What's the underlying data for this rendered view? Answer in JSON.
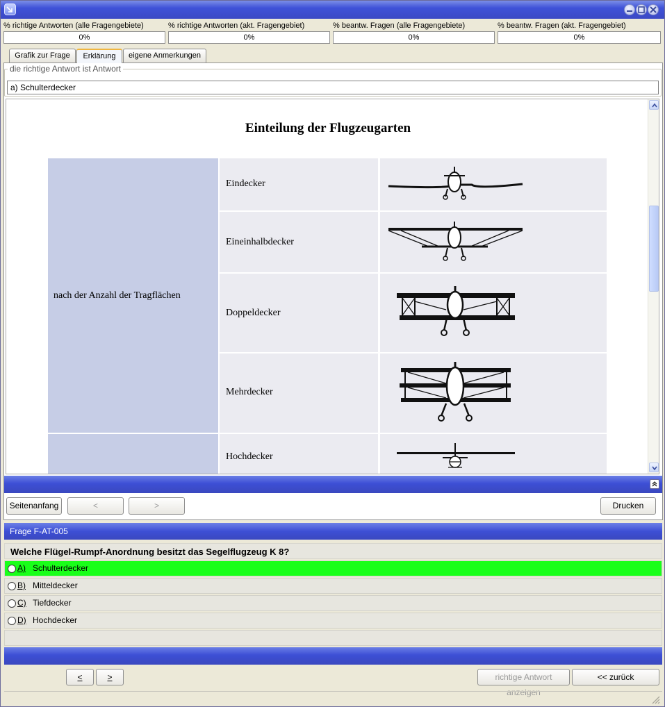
{
  "window": {
    "title": ""
  },
  "stats": [
    {
      "label": "% richtige Antworten (alle Fragengebiete)",
      "value": "0%"
    },
    {
      "label": "% richtige Antworten (akt. Fragengebiet)",
      "value": "0%"
    },
    {
      "label": "% beantw. Fragen (alle Fragengebiete)",
      "value": "0%"
    },
    {
      "label": "% beantw. Fragen (akt.  Fragengebiet)",
      "value": "0%"
    }
  ],
  "tabs": [
    {
      "label": "Grafik zur Frage",
      "active": false
    },
    {
      "label": "Erklärung",
      "active": true
    },
    {
      "label": "eigene Anmerkungen",
      "active": false
    }
  ],
  "answer_group": {
    "legend": "die richtige Antwort ist Antwort",
    "value": "a) Schulterdecker"
  },
  "document": {
    "title": "Einteilung der Flugzeugarten",
    "category": "nach der Anzahl der Tragflächen",
    "rows": [
      {
        "label": "Eindecker",
        "icon": "monoplane-icon"
      },
      {
        "label": "Eineinhalbdecker",
        "icon": "sesquiplane-icon"
      },
      {
        "label": "Doppeldecker",
        "icon": "biplane-icon"
      },
      {
        "label": "Mehrdecker",
        "icon": "triplane-icon"
      },
      {
        "label": "Hochdecker",
        "icon": "high-wing-icon"
      }
    ]
  },
  "nav": {
    "top": "Seitenanfang",
    "back": "<",
    "forward": ">",
    "print": "Drucken"
  },
  "question": {
    "header": "Frage F-AT-005",
    "text": "Welche Flügel-Rumpf-Anordnung besitzt das Segelflugzeug K 8?",
    "options": [
      {
        "letter": "A)",
        "text": "Schulterdecker",
        "selected": true
      },
      {
        "letter": "B)",
        "text": "Mitteldecker",
        "selected": false
      },
      {
        "letter": "C)",
        "text": "Tiefdecker",
        "selected": false
      },
      {
        "letter": "D)",
        "text": "Hochdecker",
        "selected": false
      }
    ]
  },
  "footer": {
    "prev": "<",
    "next": ">",
    "show_answer": "richtige Antwort anzeigen",
    "back": "<< zurück"
  },
  "colors": {
    "titlebar": "#3f52d8",
    "selected_answer": "#19ff19",
    "category_cell": "#c6cde6",
    "table_cell": "#ebebf1"
  }
}
